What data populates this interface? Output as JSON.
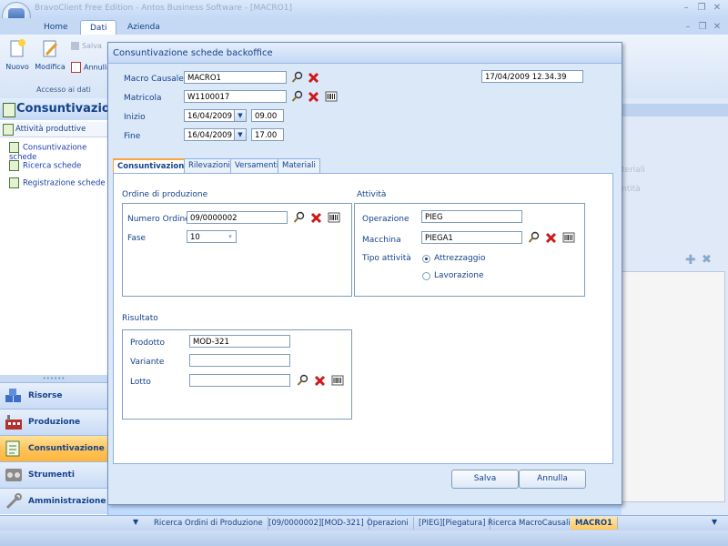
{
  "window": {
    "title": "BravoClient Free Edition - Antos Business Software - [MACRO1]"
  },
  "ribbon": {
    "tabs": [
      {
        "label": "Home"
      },
      {
        "label": "Dati"
      },
      {
        "label": "Azienda"
      }
    ],
    "buttons": {
      "nuovo": "Nuovo",
      "modifica": "Modifica",
      "salva": "Salva",
      "annulla": "Annulla"
    },
    "group_label": "Accesso ai dati"
  },
  "sidebar": {
    "header": "Consuntivazione",
    "section": "Attività produttive",
    "links": [
      {
        "label": "Consuntivazione schede"
      },
      {
        "label": "Ricerca schede"
      },
      {
        "label": "Registrazione schede"
      }
    ],
    "splitter": "••••••",
    "nav": [
      {
        "label": "Risorse",
        "icon": "resources-icon"
      },
      {
        "label": "Produzione",
        "icon": "factory-icon"
      },
      {
        "label": "Consuntivazione",
        "icon": "checklist-icon",
        "active": true
      },
      {
        "label": "Strumenti",
        "icon": "tools-icon"
      },
      {
        "label": "Amministrazione",
        "icon": "wrench-icon"
      }
    ]
  },
  "background_panel": {
    "ghost1": "teriali",
    "ghost2": "ntità"
  },
  "dialog": {
    "title": "Consuntivazione schede backoffice",
    "datetime": "17/04/2009 12.34.39",
    "header_fields": {
      "macro_causale": {
        "label": "Macro Causale",
        "value": "MACRO1"
      },
      "matricola": {
        "label": "Matricola",
        "value": "W1100017"
      },
      "inizio": {
        "label": "Inizio",
        "date": "16/04/2009",
        "time": "09.00"
      },
      "fine": {
        "label": "Fine",
        "date": "16/04/2009",
        "time": "17.00"
      }
    },
    "tabs": [
      {
        "label": "Consuntivazione"
      },
      {
        "label": "Rilevazioni"
      },
      {
        "label": "Versamenti"
      },
      {
        "label": "Materiali"
      }
    ],
    "ordine": {
      "title": "Ordine di produzione",
      "numero_ordine": {
        "label": "Numero Ordine",
        "value": "09/0000002"
      },
      "fase": {
        "label": "Fase",
        "value": "10"
      }
    },
    "attivita": {
      "title": "Attività",
      "operazione": {
        "label": "Operazione",
        "value": "PIEG"
      },
      "macchina": {
        "label": "Macchina",
        "value": "PIEGA1"
      },
      "tipo": {
        "label": "Tipo attività",
        "options": [
          "Attrezzaggio",
          "Lavorazione"
        ],
        "selected": "Attrezzaggio"
      }
    },
    "risultato": {
      "title": "Risultato",
      "prodotto": {
        "label": "Prodotto",
        "value": "MOD-321"
      },
      "variante": {
        "label": "Variante",
        "value": ""
      },
      "lotto": {
        "label": "Lotto",
        "value": ""
      }
    },
    "buttons": {
      "salva": "Salva",
      "annulla": "Annulla"
    }
  },
  "taskbar": {
    "tabs": [
      {
        "label": "Ricerca Ordini di Produzione"
      },
      {
        "label": "[09/0000002][MOD-321]"
      },
      {
        "label": "Operazioni"
      },
      {
        "label": "[PIEG][Piegatura]"
      },
      {
        "label": "Ricerca MacroCausali"
      },
      {
        "label": "MACRO1",
        "active": true
      }
    ]
  },
  "colors": {
    "accent": "#15428b",
    "ribbon_bg": "#bfdbff",
    "active_orange": "#ffc55d",
    "delete_red": "#cc1a1a"
  }
}
